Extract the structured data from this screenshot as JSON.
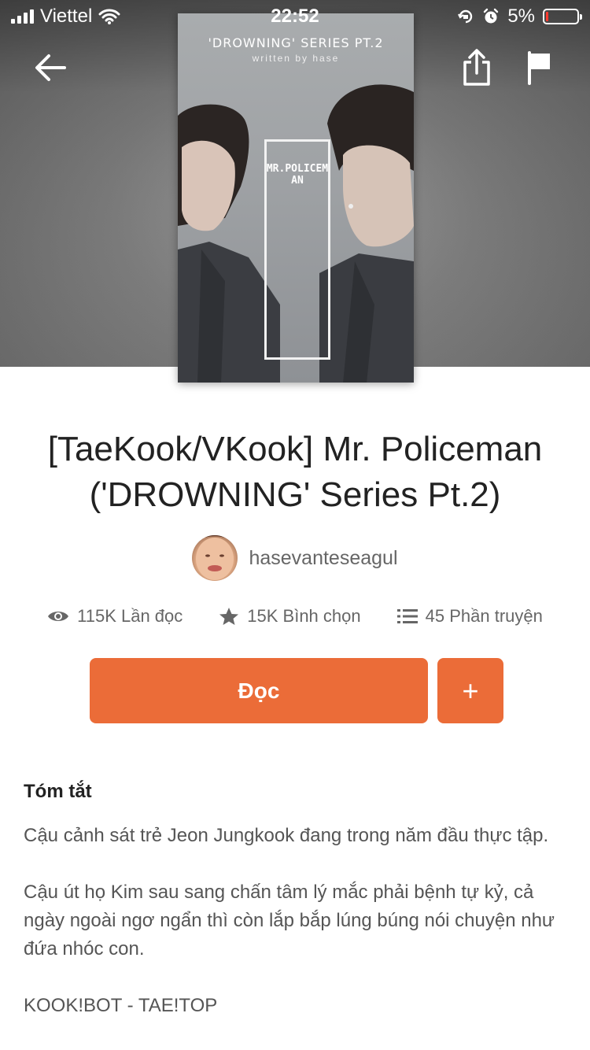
{
  "status_bar": {
    "carrier": "Viettel",
    "time": "22:52",
    "battery_percent": "5%",
    "battery_level": 0.05,
    "battery_color": "#ff3b30"
  },
  "nav": {
    "back_icon": "arrow-left-icon",
    "share_icon": "share-icon",
    "flag_icon": "flag-icon"
  },
  "cover": {
    "series_text": "'DROWNING' SERIES PT.2",
    "author_text": "written by hase",
    "vertical_title": "MR.POLICEMAN"
  },
  "story": {
    "title": "[TaeKook/VKook] Mr. Policeman ('DROWNING' Series Pt.2)",
    "author": "hasevanteseagul"
  },
  "stats": {
    "reads": "115K Lần đọc",
    "votes": "15K Bình chọn",
    "parts": "45 Phần truyện"
  },
  "actions": {
    "read_label": "Đọc",
    "add_label": "+",
    "accent_color": "#eb6c38"
  },
  "summary": {
    "heading": "Tóm tắt",
    "paragraphs": [
      "Cậu cảnh sát trẻ Jeon Jungkook đang trong năm đầu thực tập.",
      "Cậu út họ Kim sau sang chấn tâm lý mắc phải bệnh tự kỷ, cả ngày ngoài ngơ ngẩn thì còn lắp bắp lúng búng nói chuyện như đứa nhóc con.",
      "KOOK!BOT - TAE!TOP"
    ]
  }
}
